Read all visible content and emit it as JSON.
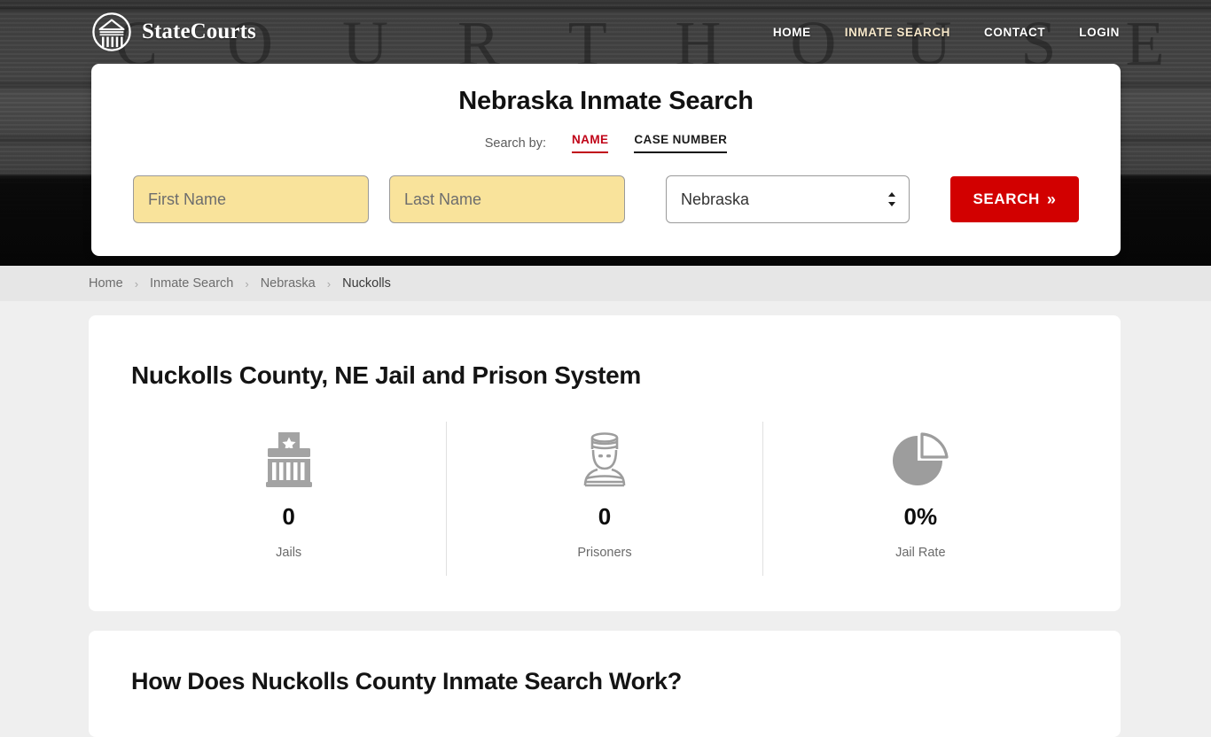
{
  "header": {
    "brand_name": "StateCourts",
    "logo_icon": "courthouse-circle-icon",
    "nav": [
      {
        "label": "HOME",
        "active": false
      },
      {
        "label": "INMATE SEARCH",
        "active": true
      },
      {
        "label": "CONTACT",
        "active": false
      },
      {
        "label": "LOGIN",
        "active": false
      }
    ]
  },
  "hero": {
    "background_text": "C O U R T   H O U S E",
    "background_description": "grayscale courthouse facade photo"
  },
  "search": {
    "title": "Nebraska Inmate Search",
    "search_by_label": "Search by:",
    "tabs": [
      {
        "label": "NAME",
        "active": true,
        "color": "#c00418"
      },
      {
        "label": "CASE NUMBER",
        "active": false,
        "color": "#111111"
      }
    ],
    "first_name_placeholder": "First Name",
    "first_name_value": "",
    "last_name_placeholder": "Last Name",
    "last_name_value": "",
    "state_selected": "Nebraska",
    "state_options": [
      "Nebraska"
    ],
    "stepper_icon": "chevron-up-down-icon",
    "submit_label": "SEARCH",
    "submit_chevron": "»",
    "submit_color": "#d20000",
    "input_color": "#f9e39b"
  },
  "breadcrumb": {
    "separator": "›",
    "items": [
      {
        "label": "Home",
        "current": false
      },
      {
        "label": "Inmate Search",
        "current": false
      },
      {
        "label": "Nebraska",
        "current": false
      },
      {
        "label": "Nuckolls",
        "current": true
      }
    ]
  },
  "main": {
    "county_heading": "Nuckolls County, NE Jail and Prison System",
    "stats": [
      {
        "icon": "jail-building-icon",
        "value": "0",
        "label": "Jails"
      },
      {
        "icon": "prisoner-icon",
        "value": "0",
        "label": "Prisoners"
      },
      {
        "icon": "pie-chart-icon",
        "value": "0%",
        "label": "Jail Rate"
      }
    ],
    "next_section_heading": "How Does Nuckolls County Inmate Search Work?"
  }
}
